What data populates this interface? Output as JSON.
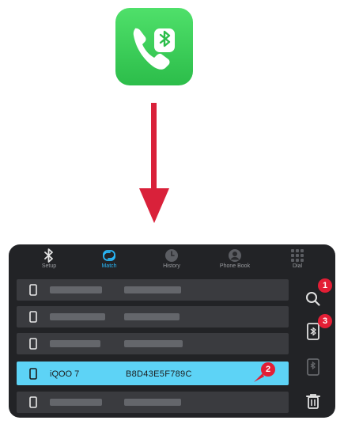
{
  "app": {
    "icon": "phone-bluetooth-icon",
    "color": "#34c759"
  },
  "nav": {
    "items": [
      {
        "label": "Setup",
        "icon": "bluetooth-icon"
      },
      {
        "label": "Match",
        "icon": "match-icon",
        "active": true
      },
      {
        "label": "History",
        "icon": "clock-icon"
      },
      {
        "label": "Phone Book",
        "icon": "contact-icon"
      },
      {
        "label": "Dial",
        "icon": "dialpad-icon"
      }
    ]
  },
  "devices": {
    "selected": {
      "name": "iQOO 7",
      "address": "B8D43E5F789C"
    }
  },
  "side": {
    "buttons": [
      "search-icon",
      "connect-phone-icon",
      "disconnect-phone-icon",
      "trash-icon"
    ]
  },
  "badges": {
    "one": "1",
    "two": "2",
    "three": "3"
  },
  "colors": {
    "accent": "#29b6f6",
    "selected_row": "#5dd3f6",
    "badge": "#e31e35",
    "arrow": "#d9213a"
  }
}
